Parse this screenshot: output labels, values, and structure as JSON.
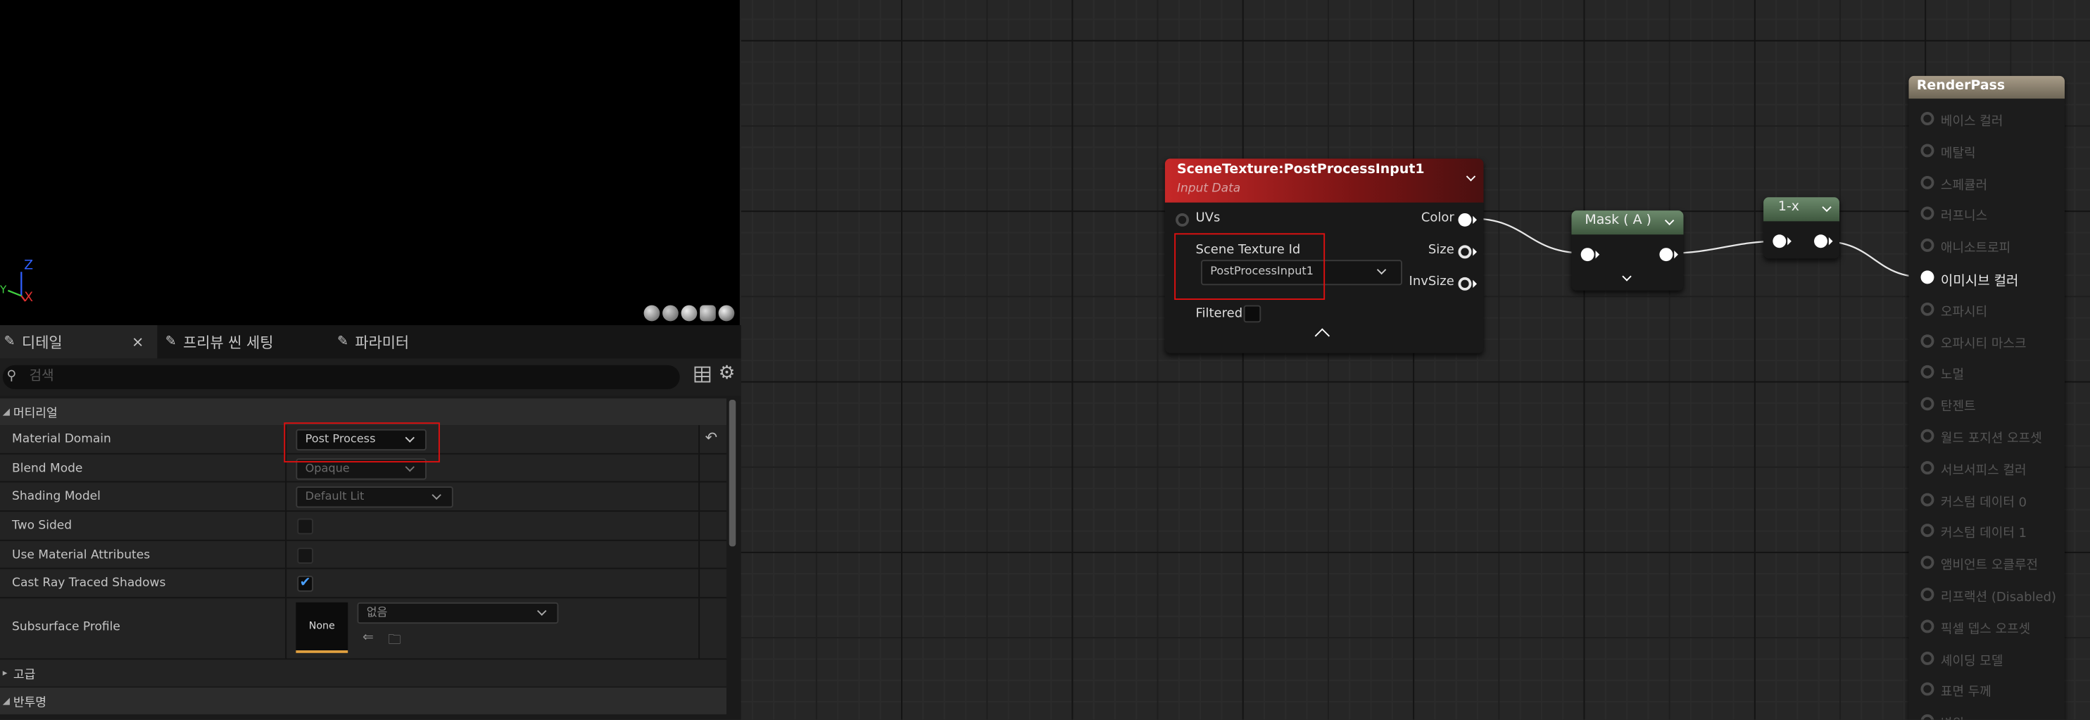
{
  "viewport": {
    "axis": {
      "x": "X",
      "y": "Y",
      "z": "Z"
    },
    "preview_icons": [
      "sphere-preview-icon",
      "cylinder-preview-icon",
      "cube-preview-icon",
      "plane-preview-icon",
      "teapot-preview-icon"
    ]
  },
  "details": {
    "tabs": [
      {
        "label": "디테일",
        "icon": "pencil-icon"
      },
      {
        "label": "프리뷰 씬 세팅",
        "icon": "pencil-icon"
      },
      {
        "label": "파라미터",
        "icon": "pencil-icon"
      }
    ],
    "close": "×",
    "search_placeholder": "검색",
    "categories": {
      "material": "머티리얼",
      "advanced": "고급",
      "translucency": "반투명"
    },
    "props": [
      {
        "label": "Material Domain",
        "value": "Post Process"
      },
      {
        "label": "Blend Mode",
        "value": "Opaque"
      },
      {
        "label": "Shading Model",
        "value": "Default Lit"
      },
      {
        "label": "Two Sided",
        "checked": false
      },
      {
        "label": "Use Material Attributes",
        "checked": false
      },
      {
        "label": "Cast Ray Traced Shadows",
        "checked": true
      },
      {
        "label": "Subsurface Profile",
        "thumb": "None",
        "value": "없음"
      }
    ]
  },
  "graph": {
    "scene_texture": {
      "title": "SceneTexture:PostProcessInput1",
      "subtitle": "Input Data",
      "input_uvs": "UVs",
      "prop_label": "Scene Texture Id",
      "prop_value": "PostProcessInput1",
      "filtered": "Filtered",
      "outputs": [
        "Color",
        "Size",
        "InvSize"
      ]
    },
    "mask": {
      "title": "Mask ( A )"
    },
    "one_minus": {
      "title": "1-x"
    },
    "render_pass": {
      "title": "RenderPass",
      "pins": [
        "베이스 컬러",
        "메탈릭",
        "스페큘러",
        "러프니스",
        "애니소트로피",
        "이미시브 컬러",
        "오파시티",
        "오파시티 마스크",
        "노멀",
        "탄젠트",
        "월드 포지션 오프셋",
        "서브서피스 컬러",
        "커스텀 데이터 0",
        "커스텀 데이터 1",
        "앰비언트 오클루전",
        "리프랙션 (Disabled)",
        "픽셀 뎁스 오프셋",
        "셰이딩 모델",
        "표면 두께",
        "변위"
      ],
      "active_index": 5
    },
    "colors": {
      "scene_header": "#8a1a1a",
      "mask_header": "#4f6a4f",
      "render_header": "#8a8070",
      "wire": "#e8e8e8",
      "highlight": "#e01010"
    }
  }
}
